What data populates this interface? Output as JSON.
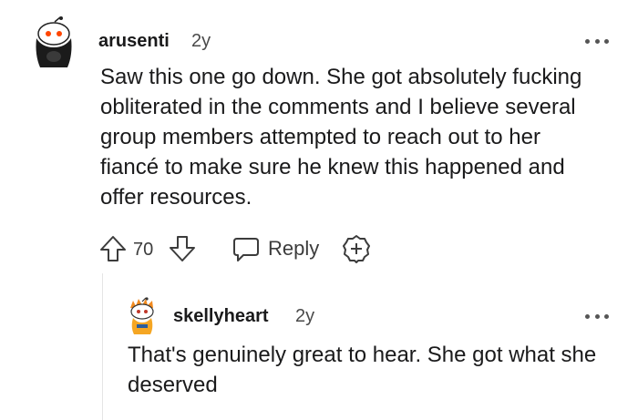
{
  "comment": {
    "author": "arusenti",
    "age": "2y",
    "text": "Saw this one go down. She got absolutely fucking obliterated in the comments and I believe several group members attempted to reach out to her fiancé to make sure he knew this happened and offer resources.",
    "avatar_icon": "snoo-avatar-icon",
    "actions": {
      "upvote_icon": "upvote-arrow-icon",
      "vote_count": "70",
      "downvote_icon": "downvote-arrow-icon",
      "reply_label": "Reply",
      "award_icon": "award-plus-icon"
    }
  },
  "reply": {
    "author": "skellyheart",
    "age": "2y",
    "text": "That's genuinely great to hear. She got what she deserved",
    "avatar_icon": "snoo-avatar-icon"
  },
  "colors": {
    "text": "#1a1a1b",
    "meta": "#4a4a4a",
    "icon": "#3c3c3c",
    "thread_line": "#e5e5e5"
  }
}
